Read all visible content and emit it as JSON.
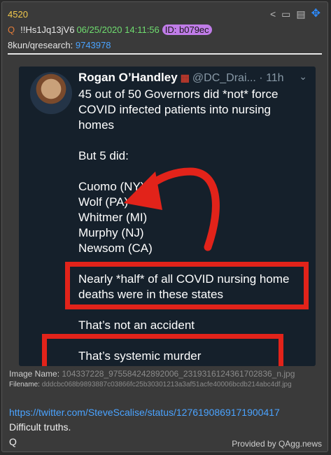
{
  "post": {
    "number": "4520",
    "q_mark": "Q",
    "tripcode": "!!Hs1Jq13jV6",
    "datetime": "06/25/2020 14:11:56",
    "id_label": "ID: b079ec",
    "board": "8kun/qresearch:",
    "thread_id": "9743978"
  },
  "toolbar": {
    "share_icon": "share-icon",
    "vr_icon": "vr-icon",
    "document_icon": "document-icon",
    "move_icon": "move-icon"
  },
  "tweet": {
    "name": "Rogan O’Handley",
    "handle": "@DC_Drai... · 11h",
    "lines": [
      "45 out of 50 Governors did *not* force",
      "COVID infected patients into nursing",
      "homes",
      "But 5 did:",
      "Cuomo (NY)",
      "Wolf (PA)",
      "Whitmer (MI)",
      "Murphy (NJ)",
      "Newsom (CA)",
      "Nearly *half* of all COVID nursing home",
      "deaths were in these states",
      "That’s not an accident",
      "That’s systemic murder"
    ],
    "accent": "#e2231a"
  },
  "image_meta": {
    "name_label": "Image Name:",
    "name_value": "104337228_975584242892006_2319316124361702836_n.jpg",
    "file_label": "Filename:",
    "file_value": "dddcbc068b9893887c03866fc25b30301213a3af51acfe40006bcdb214abc4df.jpg"
  },
  "body": {
    "link": "https://twitter.com/SteveScalise/status/1276190869171900417",
    "text1": "Difficult truths.",
    "text2": "Q"
  },
  "footer": {
    "provided": "Provided by QAgg.news"
  }
}
